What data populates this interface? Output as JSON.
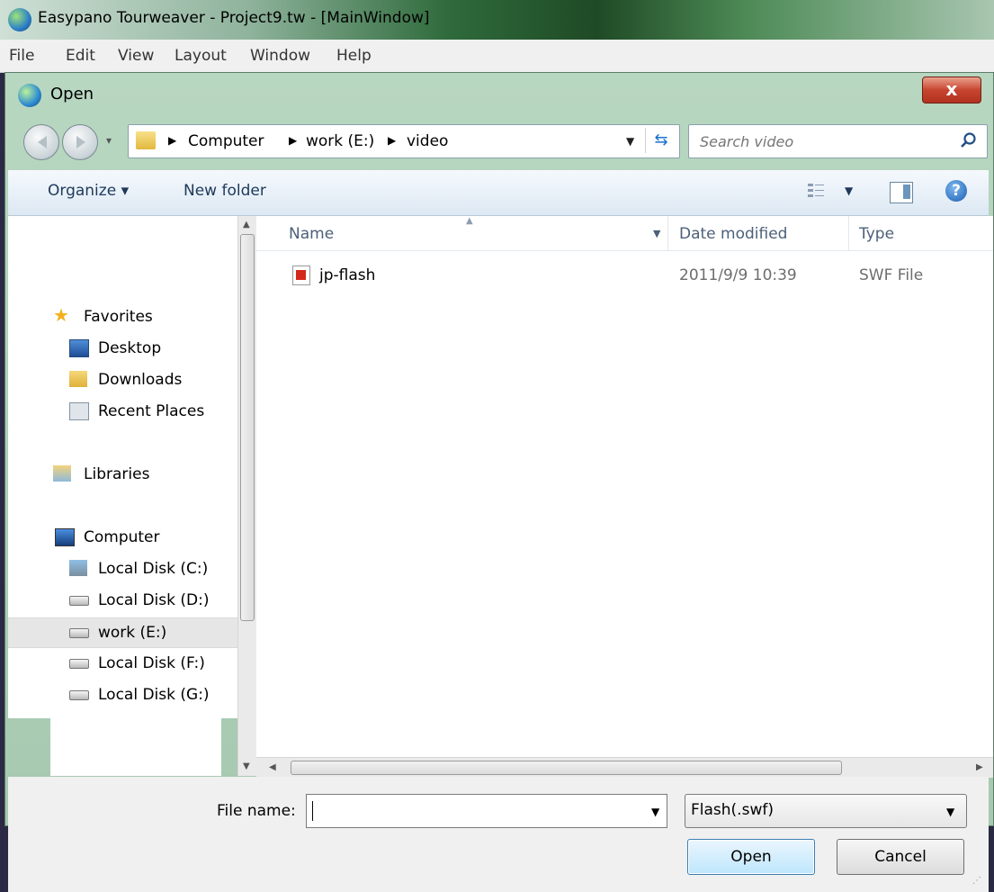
{
  "main_window": {
    "title": "Easypano Tourweaver - Project9.tw - [MainWindow]",
    "menu": [
      "File",
      "Edit",
      "View",
      "Layout",
      "Window",
      "Help"
    ]
  },
  "dialog": {
    "title": "Open",
    "close_glyph": "x",
    "breadcrumb": [
      "Computer",
      "work (E:)",
      "video"
    ],
    "search_placeholder": "Search video",
    "toolbar": {
      "organize": "Organize ▾",
      "new_folder": "New folder"
    },
    "nav": {
      "favorites": "Favorites",
      "desktop": "Desktop",
      "downloads": "Downloads",
      "recent": "Recent Places",
      "libraries": "Libraries",
      "computer": "Computer",
      "disk_c": "Local Disk (C:)",
      "disk_d": "Local Disk (D:)",
      "work_e": "work (E:)",
      "disk_f": "Local Disk (F:)",
      "disk_g": "Local Disk (G:)"
    },
    "columns": {
      "name": "Name",
      "date": "Date modified",
      "type": "Type"
    },
    "files": [
      {
        "name": "jp-flash",
        "date": "2011/9/9 10:39",
        "type": "SWF File"
      }
    ],
    "file_name_label": "File name:",
    "file_name_value": "",
    "file_type": "Flash(.swf)",
    "open_button": "Open",
    "cancel_button": "Cancel",
    "selected_nav": "work (E:)",
    "colors": {
      "accent": "#3c7fb1",
      "close": "#c74530"
    }
  }
}
